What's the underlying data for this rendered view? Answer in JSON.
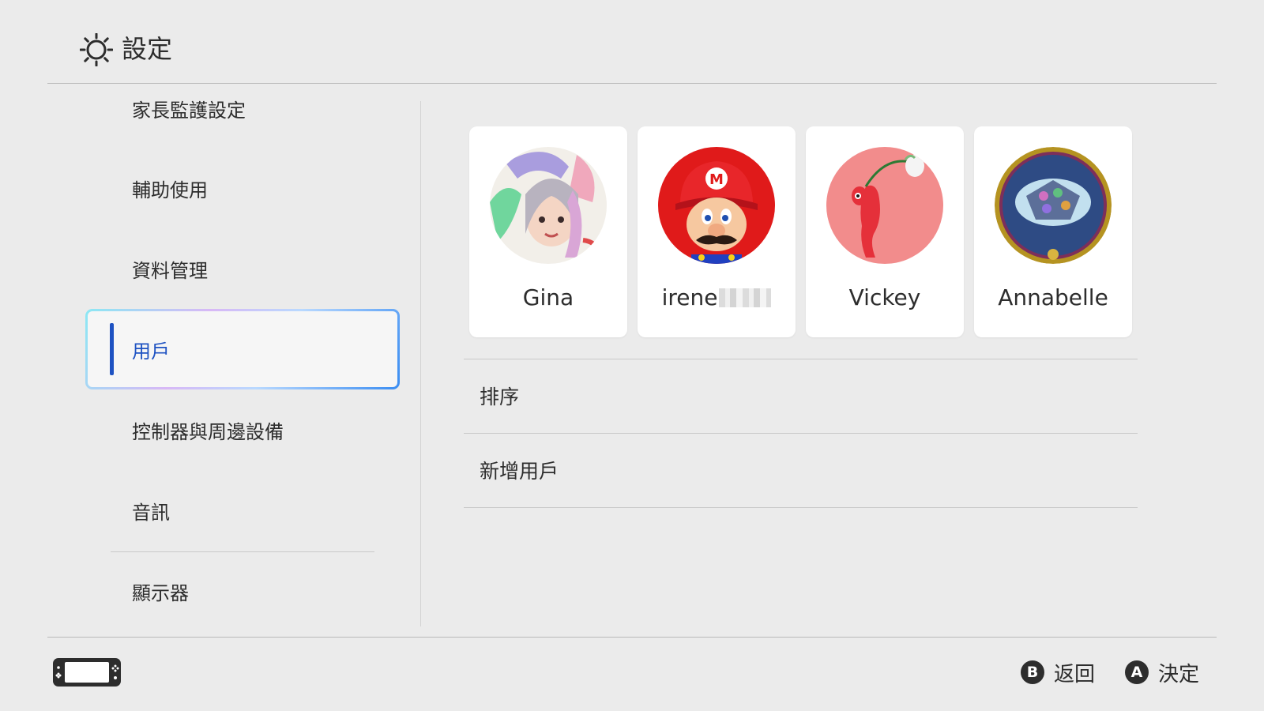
{
  "header": {
    "title": "設定",
    "icon": "sun-gear-icon"
  },
  "sidebar": {
    "items": [
      {
        "label": "家長監護設定"
      },
      {
        "label": "輔助使用"
      },
      {
        "label": "資料管理"
      },
      {
        "label": "用戶",
        "selected": true
      },
      {
        "label": "控制器與周邊設備"
      },
      {
        "label": "音訊"
      },
      {
        "label": "顯示器"
      }
    ]
  },
  "users": [
    {
      "name": "Gina"
    },
    {
      "name": "irene"
    },
    {
      "name": "Vickey"
    },
    {
      "name": "Annabelle"
    }
  ],
  "menu": {
    "sort_label": "排序",
    "add_user_label": "新增用戶"
  },
  "footer": {
    "back_button": "B",
    "back_label": "返回",
    "ok_button": "A",
    "ok_label": "決定"
  },
  "colors": {
    "accent": "#1e52c2",
    "background": "#ebebeb"
  }
}
